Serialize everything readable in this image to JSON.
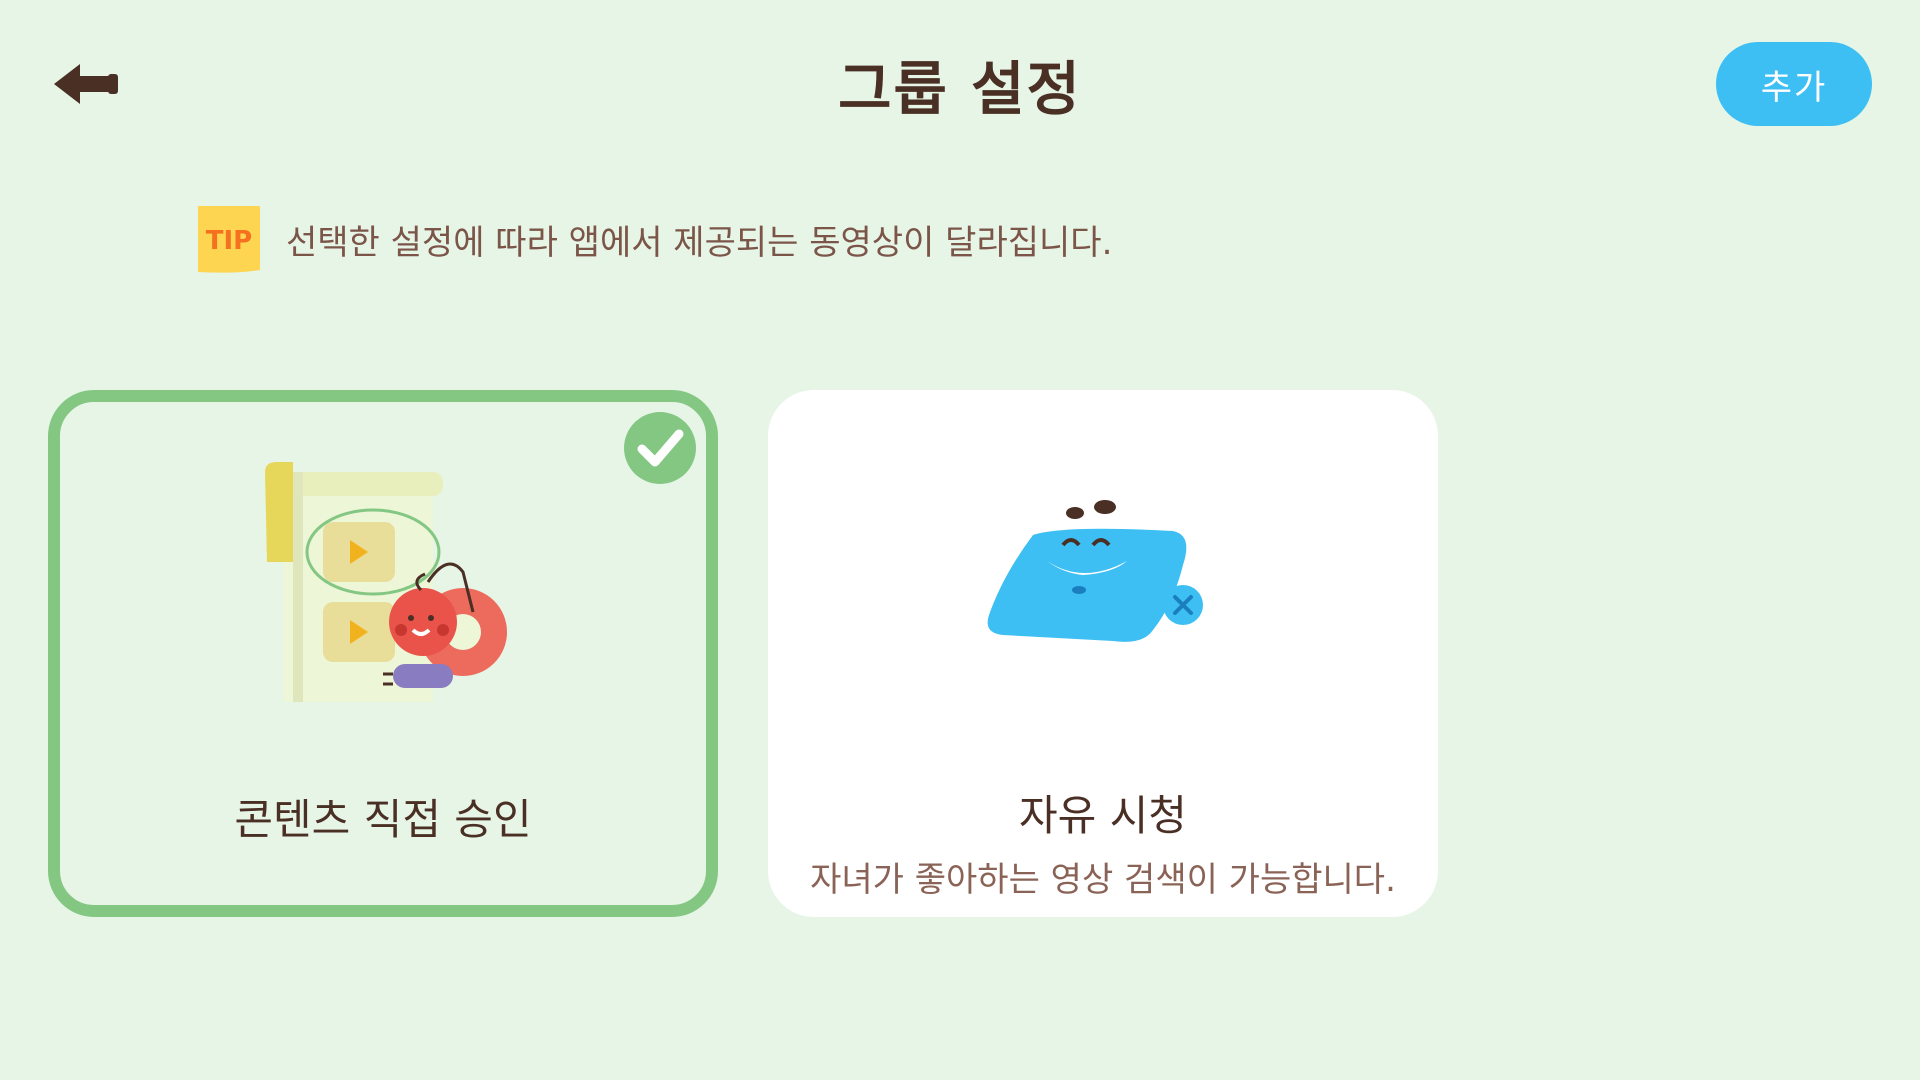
{
  "header": {
    "back_icon": "back-arrow-icon",
    "title": "그룹 설정",
    "add_label": "추가"
  },
  "tip": {
    "badge_text": "TIP",
    "text": "선택한 설정에 따라 앱에서 제공되는 동영상이 달라집니다."
  },
  "options": [
    {
      "title": "콘텐츠 직접 승인",
      "description": "",
      "selected": true,
      "icon": "content-approval-illustration"
    },
    {
      "title": "자유 시청",
      "description": "자녀가 좋아하는 영상 검색이 가능합니다.",
      "selected": false,
      "icon": "free-viewing-illustration"
    }
  ],
  "colors": {
    "background": "#e7f5e7",
    "title_text": "#4a2f25",
    "accent_blue": "#3dbff4",
    "selected_border": "#84c783",
    "tip_yellow": "#fdd551",
    "tip_text": "#f5701f"
  }
}
